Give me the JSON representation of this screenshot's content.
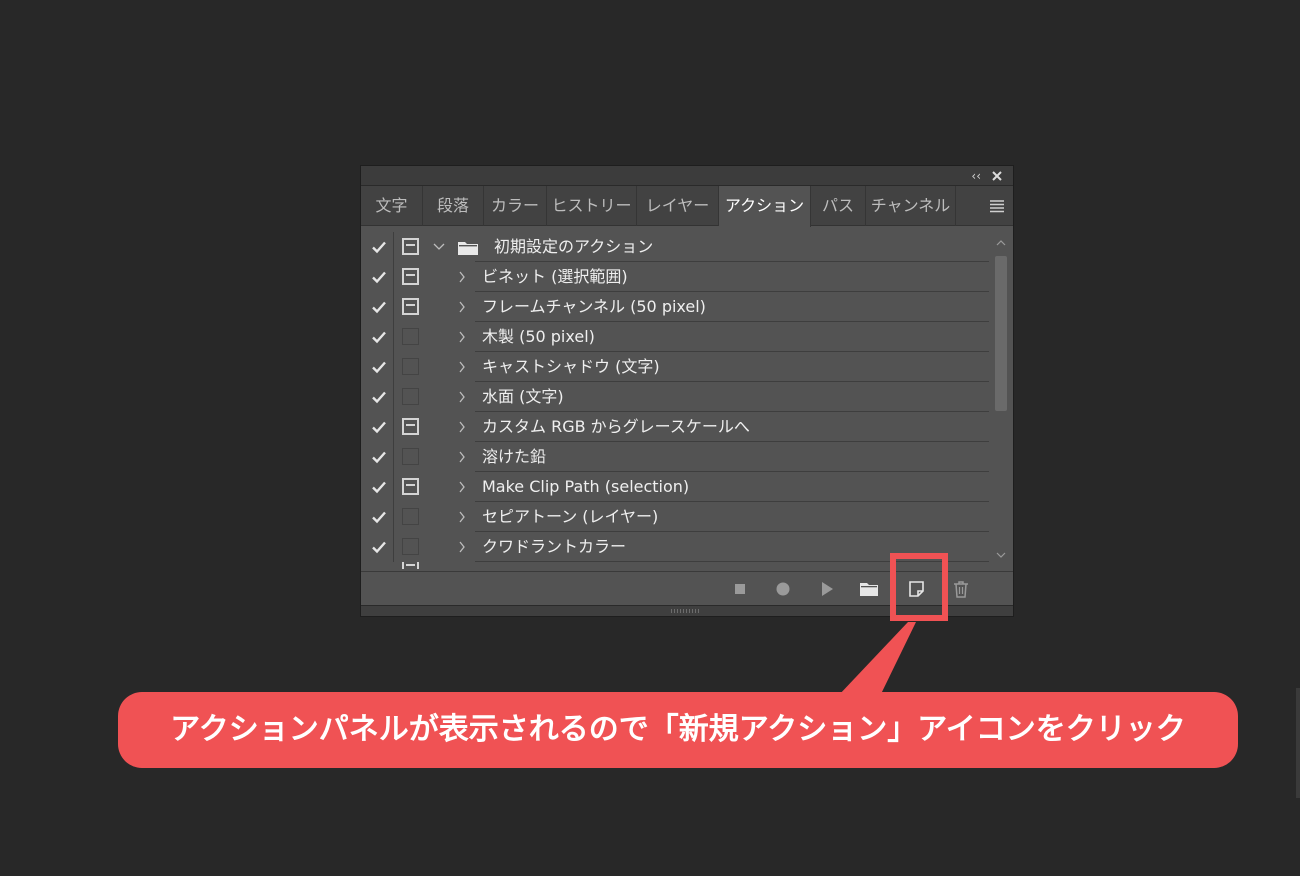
{
  "panel": {
    "tabs": [
      "文字",
      "段落",
      "カラー",
      "ヒストリー",
      "レイヤー",
      "アクション",
      "パス",
      "チャンネル"
    ],
    "active_tab": "アクション",
    "titlebar": {
      "collapse_glyph": "‹‹"
    }
  },
  "actions": {
    "set_name": "初期設定のアクション",
    "items": [
      {
        "label": "ビネット (選択範囲)",
        "dialog": true
      },
      {
        "label": "フレームチャンネル (50 pixel)",
        "dialog": true
      },
      {
        "label": "木製 (50 pixel)",
        "dialog": false
      },
      {
        "label": "キャストシャドウ (文字)",
        "dialog": false
      },
      {
        "label": "水面 (文字)",
        "dialog": false
      },
      {
        "label": "カスタム RGB からグレースケールへ",
        "dialog": true
      },
      {
        "label": "溶けた鉛",
        "dialog": false
      },
      {
        "label": "Make Clip Path (selection)",
        "dialog": true
      },
      {
        "label": "セピアトーン (レイヤー)",
        "dialog": false
      },
      {
        "label": "クワドラントカラー",
        "dialog": false
      }
    ]
  },
  "footer_buttons": [
    "stop-icon",
    "record-icon",
    "play-icon",
    "folder-icon",
    "new-action-icon",
    "trash-icon"
  ],
  "annotation": {
    "callout_text": "アクションパネルが表示されるので「新規アクション」アイコンをクリック",
    "color": "#f05254"
  },
  "colors": {
    "background": "#282828",
    "panel": "#535353",
    "accent": "#f05254"
  }
}
